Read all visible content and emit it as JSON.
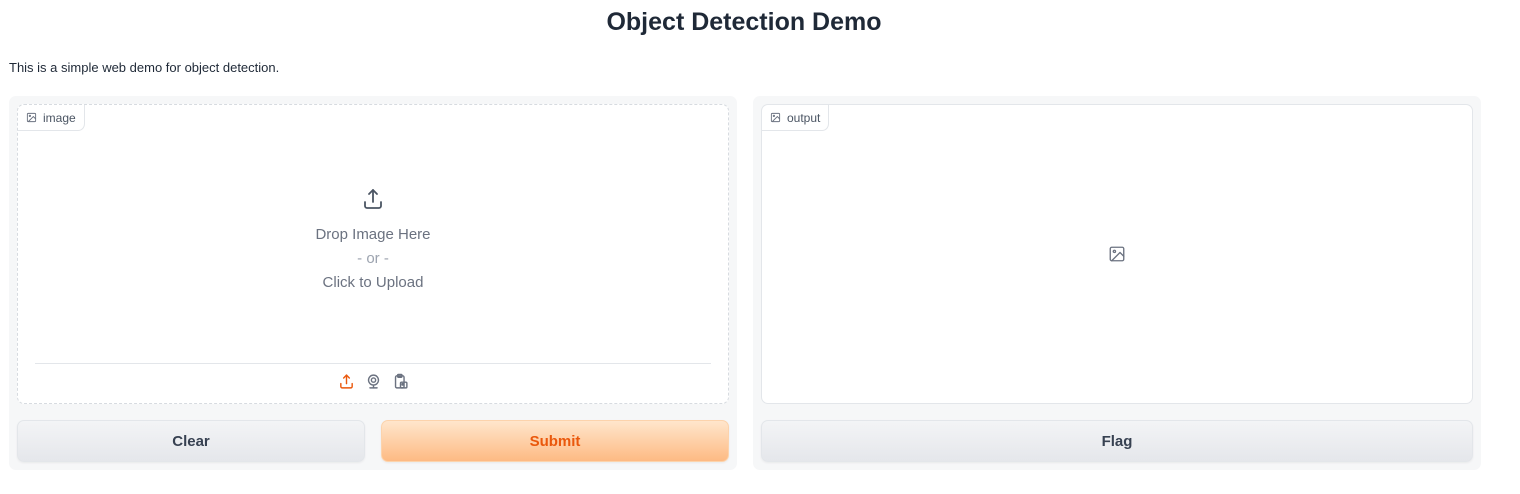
{
  "header": {
    "title": "Object Detection Demo",
    "description": "This is a simple web demo for object detection."
  },
  "input_panel": {
    "label": "image",
    "drop_text": "Drop Image Here",
    "or_text": "- or -",
    "click_text": "Click to Upload",
    "sources": [
      "upload-icon",
      "webcam-icon",
      "clipboard-icon"
    ],
    "active_source_color": "#ea580c"
  },
  "output_panel": {
    "label": "output"
  },
  "buttons": {
    "clear": "Clear",
    "submit": "Submit",
    "flag": "Flag"
  },
  "colors": {
    "accent": "#ea580c",
    "panel_bg": "#f6f7f8"
  }
}
